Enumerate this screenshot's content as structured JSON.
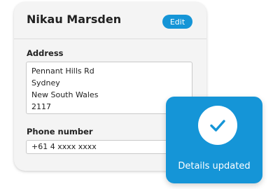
{
  "profile": {
    "name": "Nikau Marsden",
    "edit_label": "Edit"
  },
  "address": {
    "label": "Address",
    "lines": [
      "Pennant Hills Rd",
      "Sydney",
      "New South Wales",
      "2117"
    ]
  },
  "phone": {
    "label": "Phone number",
    "value": "+61 4 xxxx xxxx"
  },
  "toast": {
    "message": "Details updated",
    "icon": "check-icon"
  },
  "colors": {
    "accent": "#1595d7",
    "card_bg": "#f4f4f4"
  }
}
